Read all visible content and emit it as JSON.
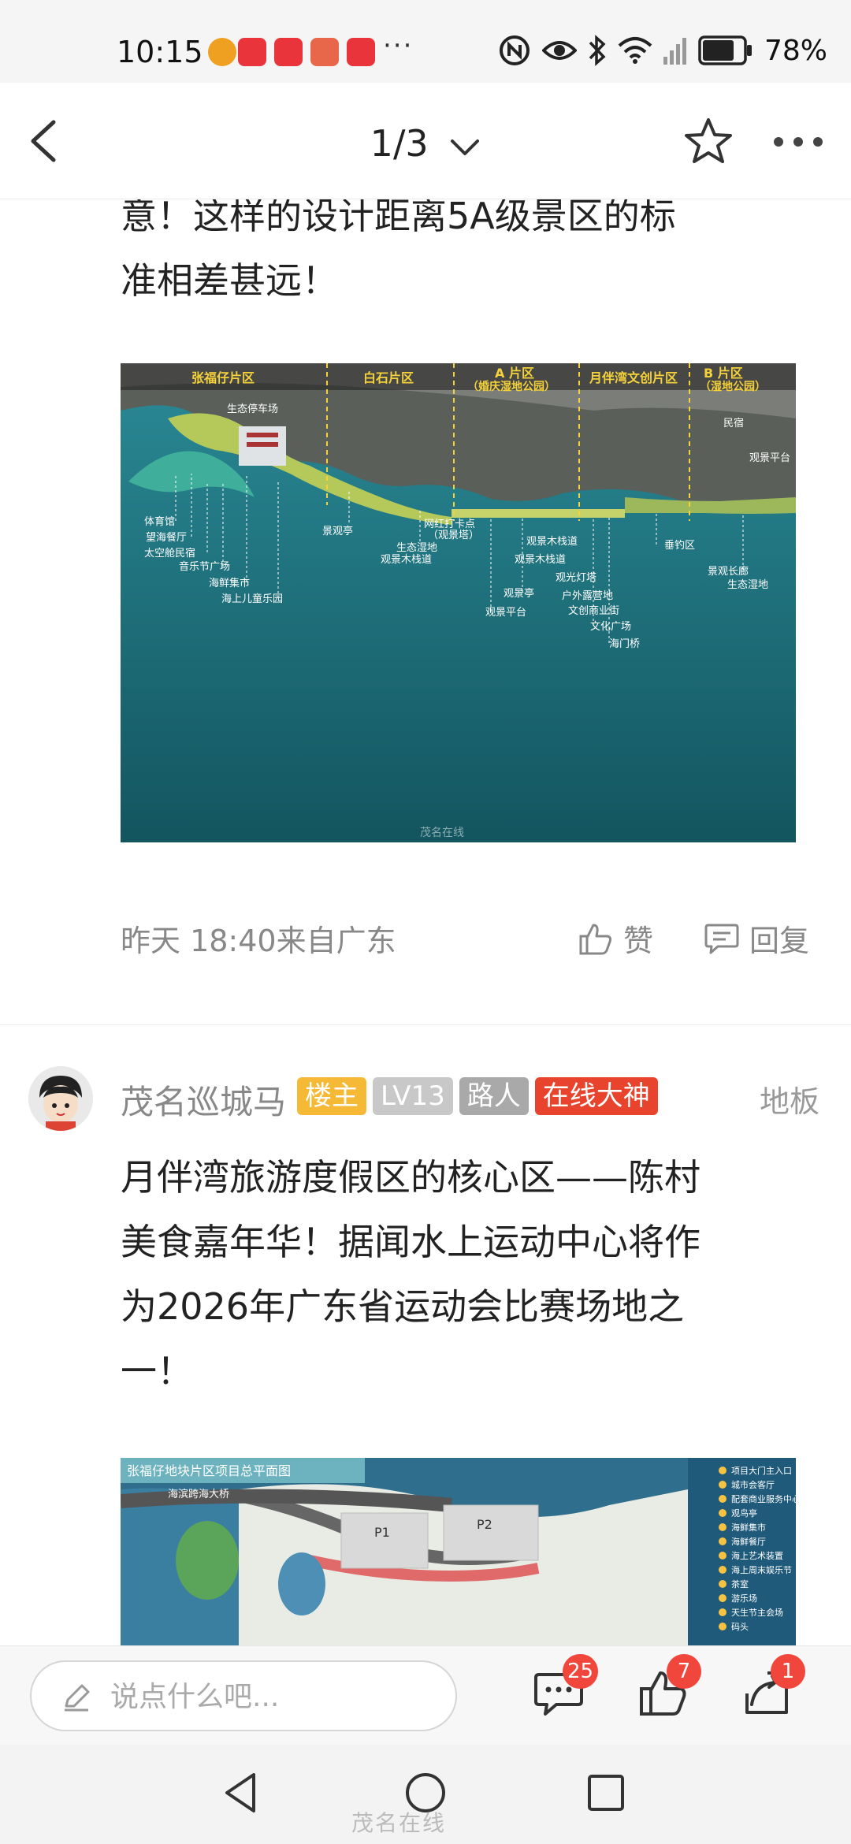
{
  "status_bar": {
    "time": "10:15",
    "more": "···",
    "battery": "78%",
    "icons": [
      "location-app-icon",
      "xiaohongshu-icon",
      "xiaohongshu-icon",
      "huawei-app-icon",
      "xiaohongshu-icon",
      "nfc-icon",
      "eye-icon",
      "bluetooth-icon",
      "wifi-icon",
      "signal-icon",
      "battery-icon"
    ],
    "battery_level": 0.78
  },
  "nav": {
    "page_indicator": "1/3"
  },
  "post": {
    "text_lines": [
      "意！这样的设计距离5A级景区的标",
      "准相差甚远！"
    ],
    "meta": {
      "time": "昨天 18:40来自广东",
      "like_label": "赞",
      "reply_label": "回复"
    }
  },
  "image_a": {
    "zones": [
      "张福仔片区",
      "白石片区",
      "A 片区",
      "（婚庆湿地公园）",
      "月伴湾文创片区",
      "B 片区",
      "（湿地公园）"
    ],
    "labels": [
      "生态停车场",
      "体育馆",
      "望海餐厅",
      "太空舱民宿",
      "音乐节广场",
      "海鲜集市",
      "海上儿童乐园",
      "景观亭",
      "生态湿地",
      "观景木栈道",
      "网红打卡点",
      "（观景塔）",
      "观景木栈道",
      "观景木栈道",
      "观景亭",
      "观景平台",
      "观光灯塔",
      "户外露营地",
      "文创商业街",
      "文化广场",
      "海门桥",
      "垂钓区",
      "景观长廊",
      "生态湿地",
      "观景平台",
      "民宿"
    ],
    "watermark": "茂名在线"
  },
  "reply": {
    "username": "茂名巡城马",
    "badges": [
      "楼主",
      "LV13",
      "路人",
      "在线大神"
    ],
    "floor": "地板",
    "text_lines": [
      "月伴湾旅游度假区的核心区——陈村",
      "美食嘉年华！据闻水上运动中心将作",
      "为2026年广东省运动会比赛场地之",
      "一！"
    ]
  },
  "image_b": {
    "title": "张福仔地块片区项目总平面图",
    "bridge_label": "海滨跨海大桥",
    "plot_labels": [
      "P1",
      "P2"
    ],
    "legend_items": [
      "项目大门主入口",
      "城市会客厅",
      "配套商业服务中心",
      "观鸟亭",
      "海鲜集市",
      "海鲜餐厅",
      "海上艺术装置",
      "海上周末娱乐节",
      "茶室",
      "游乐场",
      "天生节主会场",
      "码头"
    ]
  },
  "bottom_bar": {
    "input_placeholder": "说点什么吧...",
    "comments_count": "25",
    "likes_count": "7",
    "share_count": "1"
  },
  "system": {
    "watermark": "茂名在线"
  },
  "colors": {
    "badge_owner": "#f5b935",
    "badge_hot": "#e8432c",
    "count_badge": "#f0463c",
    "sea": "#1e7a86"
  }
}
